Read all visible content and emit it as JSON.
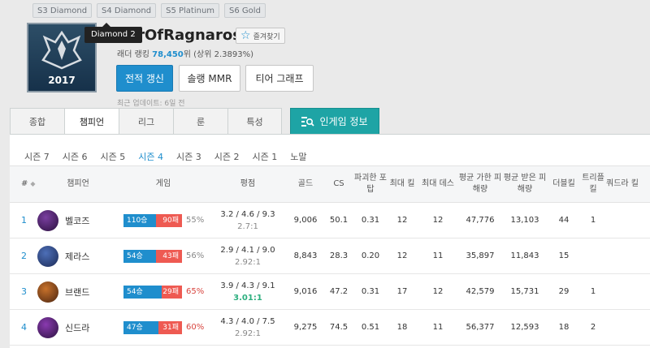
{
  "seasons_badges": [
    "S3 Diamond",
    "S4 Diamond",
    "S5 Platinum",
    "S6 Gold"
  ],
  "tooltip": "Diamond 2",
  "emblem": {
    "year": "2017"
  },
  "summoner": {
    "name": "DangerOfRagnaros",
    "visible_name": "gerOfRagnaros",
    "fav_label": "즐겨찾기"
  },
  "ranking": {
    "prefix": "래더 랭킹 ",
    "number": "78,450",
    "suffix": "위 (상위 2.3893%)"
  },
  "actions": {
    "update": "전적 갱신",
    "solo_mmr": "솔랭 MMR",
    "tier_graph": "티어 그래프"
  },
  "updated": "최근 업데이트: 6일 전",
  "tabs": [
    "종합",
    "챔피언",
    "리그",
    "룬",
    "특성"
  ],
  "active_tab": "챔피언",
  "ingame": "인게임 정보",
  "season_nav": [
    "시즌 7",
    "시즌 6",
    "시즌 5",
    "시즌 4",
    "시즌 3",
    "시즌 2",
    "시즌 1",
    "노말"
  ],
  "active_season": "시즌 4",
  "columns": [
    "#",
    "챔피언",
    "게임",
    "평점",
    "골드",
    "CS",
    "파괴한 포탑",
    "최대 킬",
    "최대 데스",
    "평균 가한 피해량",
    "평균 받은 피해량",
    "더블킬",
    "트리플 킬",
    "쿼드라 킬"
  ],
  "rows": [
    {
      "rank": "1",
      "champion": "벨코즈",
      "wins": "110승",
      "losses": "90패",
      "rate": "55%",
      "kda": "3.2 / 4.6 / 9.3",
      "ratio": "2.7:1",
      "gold": "9,006",
      "cs": "50.1",
      "towers": "0.31",
      "max_kill": "12",
      "max_death": "12",
      "dealt": "47,776",
      "taken": "13,103",
      "double": "44",
      "triple": "1",
      "quadra": ""
    },
    {
      "rank": "2",
      "champion": "제라스",
      "wins": "54승",
      "losses": "43패",
      "rate": "56%",
      "kda": "2.9 / 4.1 / 9.0",
      "ratio": "2.92:1",
      "gold": "8,843",
      "cs": "28.3",
      "towers": "0.20",
      "max_kill": "12",
      "max_death": "11",
      "dealt": "35,897",
      "taken": "11,843",
      "double": "15",
      "triple": "",
      "quadra": ""
    },
    {
      "rank": "3",
      "champion": "브랜드",
      "wins": "54승",
      "losses": "29패",
      "rate": "65%",
      "kda": "3.9 / 4.3 / 9.1",
      "ratio": "3.01:1",
      "gold": "9,016",
      "cs": "47.2",
      "towers": "0.31",
      "max_kill": "17",
      "max_death": "12",
      "dealt": "42,579",
      "taken": "15,731",
      "double": "29",
      "triple": "1",
      "quadra": ""
    },
    {
      "rank": "4",
      "champion": "신드라",
      "wins": "47승",
      "losses": "31패",
      "rate": "60%",
      "kda": "4.3 / 4.0 / 7.5",
      "ratio": "2.92:1",
      "gold": "9,275",
      "cs": "74.5",
      "towers": "0.51",
      "max_kill": "18",
      "max_death": "11",
      "dealt": "56,377",
      "taken": "12,593",
      "double": "18",
      "triple": "2",
      "quadra": ""
    }
  ],
  "win_fractions": [
    0.55,
    0.557,
    0.651,
    0.603
  ],
  "hot_rates": [
    false,
    false,
    true,
    true
  ],
  "good_ratio": [
    false,
    false,
    true,
    false
  ],
  "champ_colors": [
    [
      "#7a3fa0",
      "#2a0f3d"
    ],
    [
      "#4d6fb8",
      "#1b2a55"
    ],
    [
      "#c8722b",
      "#4a2410"
    ],
    [
      "#8a3ab0",
      "#2b123f"
    ]
  ]
}
